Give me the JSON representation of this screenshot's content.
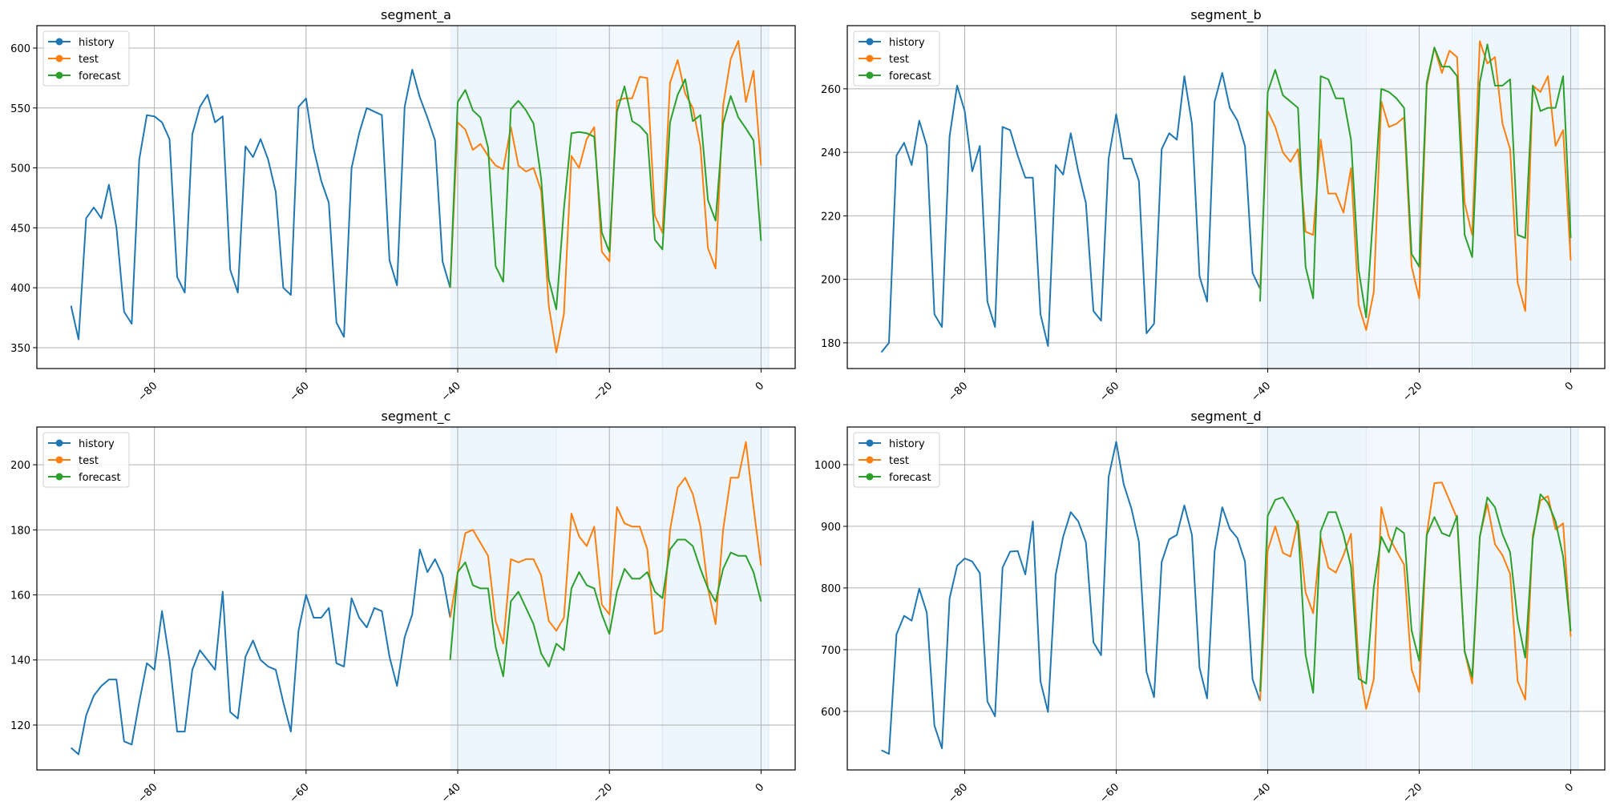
{
  "chart_data": [
    {
      "type": "line",
      "title": "segment_a",
      "xlabel": "",
      "ylabel": "",
      "xlim": [
        -95.5,
        4.5
      ],
      "ylim": [
        332.6,
        618.7
      ],
      "xticks": [
        -80,
        -60,
        -40,
        -20,
        0
      ],
      "xtick_labels": [
        "−80",
        "−60",
        "−40",
        "−20",
        "0"
      ],
      "yticks": [
        350,
        400,
        450,
        500,
        550,
        600
      ],
      "ytick_labels": [
        "350",
        "400",
        "450",
        "500",
        "550",
        "600"
      ],
      "grid": true,
      "legend": "top-left",
      "bands": [
        [
          -41,
          -27
        ],
        [
          -27,
          -13
        ],
        [
          -13,
          1
        ]
      ],
      "series": [
        {
          "name": "history",
          "x_start": -91,
          "values": [
            385,
            357,
            458,
            467,
            458,
            486,
            450,
            380,
            370,
            507,
            544,
            543,
            538,
            524,
            409,
            396,
            528,
            551,
            561,
            538,
            543,
            415,
            396,
            518,
            509,
            524,
            507,
            480,
            400,
            394,
            551,
            558,
            516,
            489,
            471,
            371,
            359,
            500,
            529,
            550,
            547,
            544,
            423,
            402,
            551,
            582,
            559,
            542,
            523,
            422,
            400
          ]
        },
        {
          "name": "test",
          "x_start": -41,
          "values": [
            400,
            538,
            532,
            515,
            520,
            510,
            502,
            499,
            534,
            502,
            497,
            500,
            481,
            385,
            346,
            378,
            510,
            500,
            524,
            534,
            430,
            422,
            556,
            558,
            558,
            576,
            575,
            460,
            446,
            571,
            590,
            562,
            550,
            518,
            433,
            416,
            552,
            591,
            606,
            555,
            581,
            502
          ]
        },
        {
          "name": "forecast",
          "x_start": -41,
          "values": [
            400,
            555,
            565,
            548,
            542,
            517,
            418,
            405,
            549,
            556,
            548,
            537,
            491,
            407,
            382,
            466,
            529,
            530,
            529,
            526,
            446,
            430,
            547,
            568,
            539,
            535,
            528,
            440,
            432,
            538,
            561,
            574,
            539,
            544,
            473,
            456,
            537,
            560,
            542,
            533,
            523,
            439
          ]
        }
      ]
    },
    {
      "type": "line",
      "title": "segment_b",
      "xlabel": "",
      "ylabel": "",
      "xlim": [
        -95.5,
        4.5
      ],
      "ylim": [
        171.9,
        279.9
      ],
      "xticks": [
        -80,
        -60,
        -40,
        -20,
        0
      ],
      "xtick_labels": [
        "−80",
        "−60",
        "−40",
        "−20",
        "0"
      ],
      "yticks": [
        180,
        200,
        220,
        240,
        260
      ],
      "ytick_labels": [
        "180",
        "200",
        "220",
        "240",
        "260"
      ],
      "grid": true,
      "legend": "top-left",
      "bands": [
        [
          -41,
          -27
        ],
        [
          -27,
          -13
        ],
        [
          -13,
          1
        ]
      ],
      "series": [
        {
          "name": "history",
          "x_start": -91,
          "values": [
            177,
            180,
            239,
            243,
            236,
            250,
            242,
            189,
            185,
            245,
            261,
            253,
            234,
            242,
            193,
            185,
            248,
            247,
            239,
            232,
            232,
            189,
            179,
            236,
            233,
            246,
            234,
            224,
            190,
            187,
            238,
            252,
            238,
            238,
            231,
            183,
            186,
            241,
            246,
            244,
            264,
            249,
            201,
            193,
            256,
            265,
            254,
            250,
            242,
            202,
            197
          ]
        },
        {
          "name": "test",
          "x_start": -41,
          "values": [
            197,
            253,
            248,
            240,
            237,
            241,
            215,
            214,
            244,
            227,
            227,
            221,
            235,
            192,
            184,
            196,
            256,
            248,
            249,
            251,
            204,
            194,
            261,
            273,
            265,
            272,
            270,
            224,
            214,
            275,
            268,
            270,
            249,
            241,
            199,
            190,
            261,
            259,
            264,
            242,
            247,
            206
          ]
        },
        {
          "name": "forecast",
          "x_start": -41,
          "values": [
            193,
            259,
            266,
            258,
            256,
            254,
            204,
            194,
            264,
            263,
            257,
            257,
            244,
            203,
            188,
            223,
            260,
            259,
            257,
            254,
            208,
            204,
            262,
            273,
            267,
            267,
            264,
            214,
            207,
            262,
            274,
            261,
            261,
            263,
            214,
            213,
            261,
            253,
            254,
            254,
            264,
            213
          ]
        }
      ]
    },
    {
      "type": "line",
      "title": "segment_c",
      "xlabel": "",
      "ylabel": "",
      "xlim": [
        -95.5,
        4.5
      ],
      "ylim": [
        106.2,
        211.6
      ],
      "xticks": [
        -80,
        -60,
        -40,
        -20,
        0
      ],
      "xtick_labels": [
        "−80",
        "−60",
        "−40",
        "−20",
        "0"
      ],
      "yticks": [
        120,
        140,
        160,
        180,
        200
      ],
      "ytick_labels": [
        "120",
        "140",
        "160",
        "180",
        "200"
      ],
      "grid": true,
      "legend": "top-left",
      "bands": [
        [
          -41,
          -27
        ],
        [
          -27,
          -13
        ],
        [
          -13,
          1
        ]
      ],
      "series": [
        {
          "name": "history",
          "x_start": -91,
          "values": [
            113,
            111,
            123,
            129,
            132,
            134,
            134,
            115,
            114,
            127,
            139,
            137,
            155,
            140,
            118,
            118,
            137,
            143,
            140,
            137,
            161,
            124,
            122,
            141,
            146,
            140,
            138,
            137,
            127,
            118,
            149,
            160,
            153,
            153,
            156,
            139,
            138,
            159,
            153,
            150,
            156,
            155,
            141,
            132,
            147,
            154,
            174,
            167,
            171,
            166,
            153
          ]
        },
        {
          "name": "test",
          "x_start": -41,
          "values": [
            153,
            167,
            179,
            180,
            176,
            172,
            152,
            145,
            171,
            170,
            171,
            171,
            166,
            152,
            149,
            153,
            185,
            178,
            175,
            181,
            157,
            154,
            187,
            182,
            181,
            181,
            174,
            148,
            149,
            180,
            193,
            196,
            191,
            181,
            162,
            151,
            180,
            196,
            196,
            207,
            187,
            169
          ]
        },
        {
          "name": "forecast",
          "x_start": -41,
          "values": [
            140,
            167,
            170,
            163,
            162,
            162,
            144,
            135,
            158,
            161,
            156,
            151,
            142,
            138,
            145,
            143,
            162,
            167,
            163,
            162,
            154,
            148,
            161,
            168,
            165,
            165,
            167,
            161,
            159,
            174,
            177,
            177,
            175,
            168,
            162,
            158,
            168,
            173,
            172,
            172,
            167,
            158
          ]
        }
      ]
    },
    {
      "type": "line",
      "title": "segment_d",
      "xlabel": "",
      "ylabel": "",
      "xlim": [
        -95.5,
        4.5
      ],
      "ylim": [
        505,
        1061
      ],
      "xticks": [
        -80,
        -60,
        -40,
        -20,
        0
      ],
      "xtick_labels": [
        "−80",
        "−60",
        "−40",
        "−20",
        "0"
      ],
      "yticks": [
        600,
        700,
        800,
        900,
        1000
      ],
      "ytick_labels": [
        "600",
        "700",
        "800",
        "900",
        "1000"
      ],
      "grid": true,
      "legend": "top-left",
      "bands": [
        [
          -41,
          -27
        ],
        [
          -27,
          -13
        ],
        [
          -13,
          1
        ]
      ],
      "series": [
        {
          "name": "history",
          "x_start": -91,
          "values": [
            537,
            531,
            725,
            755,
            747,
            799,
            760,
            577,
            540,
            783,
            836,
            848,
            843,
            824,
            616,
            592,
            833,
            859,
            860,
            822,
            908,
            649,
            599,
            821,
            883,
            923,
            908,
            874,
            712,
            691,
            980,
            1037,
            968,
            929,
            875,
            664,
            623,
            842,
            879,
            886,
            934,
            886,
            671,
            621,
            860,
            931,
            896,
            881,
            843,
            652,
            617
          ]
        },
        {
          "name": "test",
          "x_start": -41,
          "values": [
            617,
            861,
            900,
            857,
            851,
            909,
            793,
            759,
            882,
            833,
            825,
            853,
            888,
            678,
            604,
            652,
            931,
            883,
            860,
            838,
            668,
            631,
            887,
            970,
            971,
            942,
            913,
            697,
            645,
            884,
            936,
            871,
            853,
            823,
            649,
            619,
            886,
            942,
            949,
            895,
            905,
            721
          ]
        },
        {
          "name": "forecast",
          "x_start": -41,
          "values": [
            632,
            917,
            943,
            947,
            926,
            901,
            692,
            630,
            892,
            923,
            923,
            887,
            835,
            653,
            645,
            801,
            883,
            858,
            898,
            889,
            731,
            682,
            886,
            915,
            889,
            884,
            917,
            697,
            656,
            883,
            947,
            931,
            887,
            858,
            748,
            687,
            879,
            952,
            938,
            908,
            851,
            730
          ]
        }
      ]
    }
  ],
  "legend_items": [
    "history",
    "test",
    "forecast"
  ],
  "colors": {
    "history": "#1f77b4",
    "test": "#ff7f0e",
    "forecast": "#2ca02c",
    "band_dark": "#ddeef9",
    "band_light": "#eaf4fb",
    "grid": "#b0b0b0"
  }
}
